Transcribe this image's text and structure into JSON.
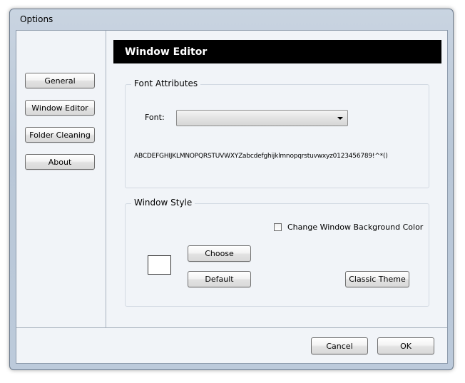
{
  "window": {
    "title": "Options"
  },
  "sidebar": {
    "items": [
      {
        "label": "General"
      },
      {
        "label": "Window Editor"
      },
      {
        "label": "Folder Cleaning"
      },
      {
        "label": "About"
      }
    ]
  },
  "main": {
    "header": "Window Editor",
    "font_attributes": {
      "title": "Font Attributes",
      "font_label": "Font:",
      "font_value": "",
      "sample_text": "ABCDEFGHIJKLMNOPQRSTUVWXYZabcdefghijklmnopqrstuvwxyz0123456789!^*()"
    },
    "window_style": {
      "title": "Window Style",
      "checkbox_label": "Change Window Background Color",
      "checkbox_checked": false,
      "swatch_color": "#ffffff",
      "choose_label": "Choose",
      "default_label": "Default",
      "classic_theme_label": "Classic Theme"
    }
  },
  "footer": {
    "cancel_label": "Cancel",
    "ok_label": "OK"
  },
  "colors": {
    "header_bg": "#000000",
    "header_fg": "#ffffff",
    "frame": "#bccadb"
  }
}
